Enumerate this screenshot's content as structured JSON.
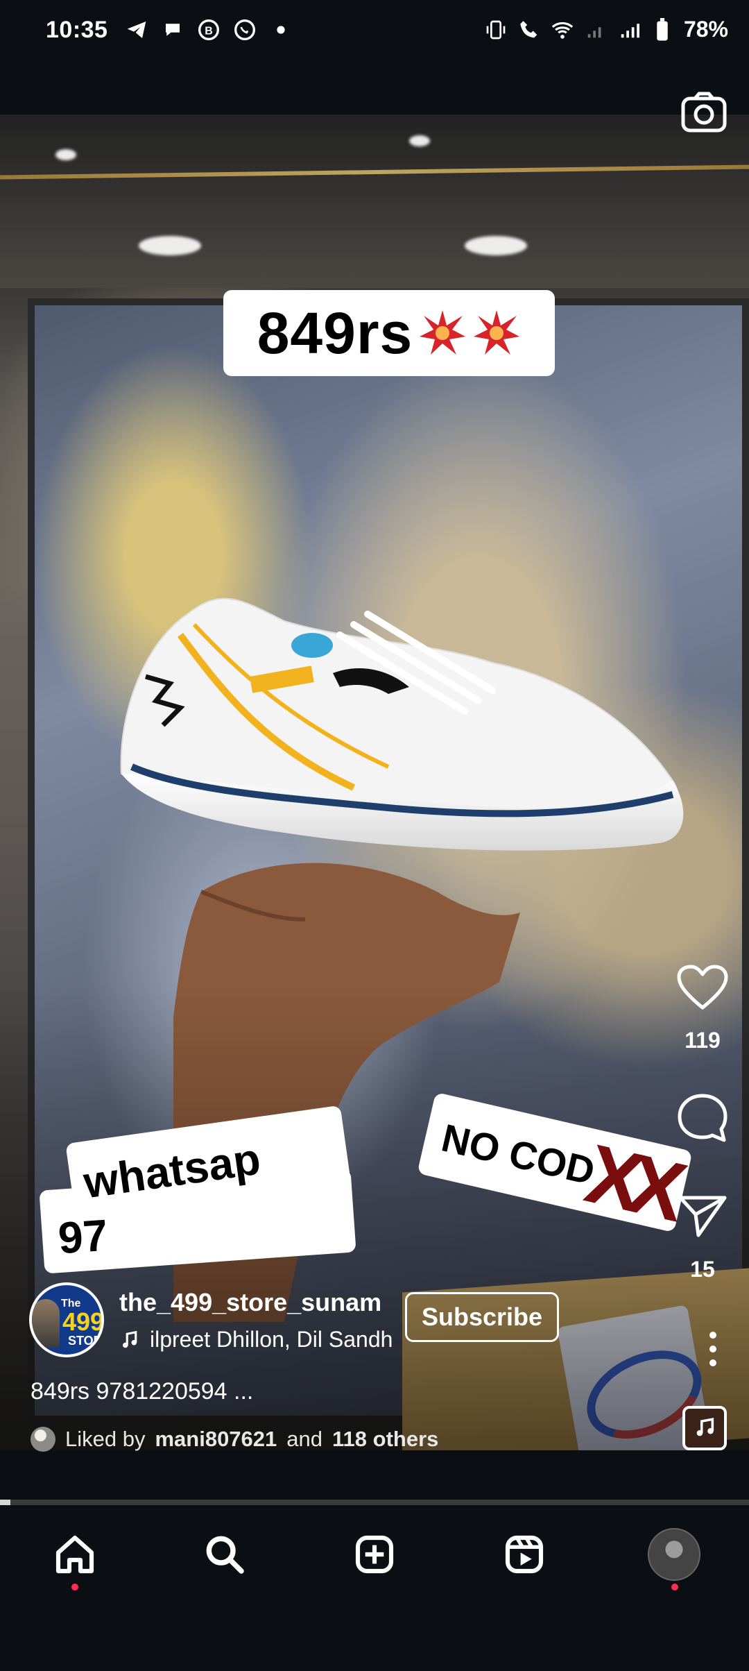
{
  "status_bar": {
    "time": "10:35",
    "battery": "78%",
    "left_icons": [
      "telegram-icon",
      "chat-icon",
      "b-icon",
      "whatsapp-icon",
      "dot-icon"
    ],
    "right_icons": [
      "vibrate-icon",
      "wifi-call-icon",
      "wifi-icon",
      "signal-icon",
      "signal-icon-2",
      "battery-icon"
    ]
  },
  "post": {
    "price_sticker": "849rs",
    "whatsapp_sticker_line1": "whatsap",
    "whatsapp_sticker_line2": "97",
    "nocod_sticker": "NO COD",
    "nocod_marks": "XX",
    "likes_count": "119",
    "shares_count": "15",
    "progress_fraction": 0.014
  },
  "author": {
    "avatar_line1": "The",
    "avatar_line2": "499",
    "avatar_line3": "STOR",
    "username": "the_499_store_sunam",
    "subscribe_label": "Subscribe",
    "audio": "ilpreet Dhillon, Dil Sandh"
  },
  "caption": {
    "text": "849rs 9781220594 ..."
  },
  "liked": {
    "prefix": "Liked by",
    "user": "mani807621",
    "and": "and",
    "others": "118 others"
  },
  "nav": {
    "items": [
      "home-icon",
      "search-icon",
      "create-icon",
      "reels-icon",
      "profile-avatar"
    ]
  }
}
